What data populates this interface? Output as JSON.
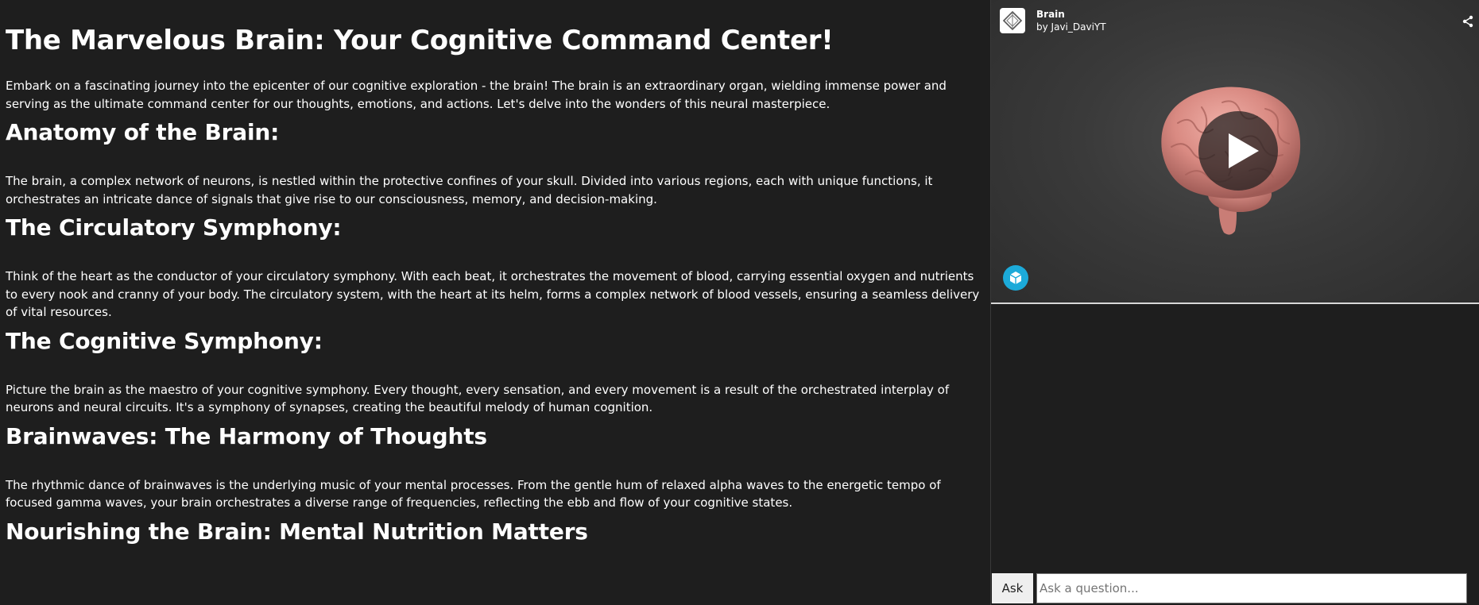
{
  "article": {
    "title": "The Marvelous Brain: Your Cognitive Command Center!",
    "intro": "Embark on a fascinating journey into the epicenter of our cognitive exploration - the brain! The brain is an extraordinary organ, wielding immense power and serving as the ultimate command center for our thoughts, emotions, and actions. Let's delve into the wonders of this neural masterpiece.",
    "sections": [
      {
        "heading": "Anatomy of the Brain:",
        "body": "The brain, a complex network of neurons, is nestled within the protective confines of your skull. Divided into various regions, each with unique functions, it orchestrates an intricate dance of signals that give rise to our consciousness, memory, and decision-making."
      },
      {
        "heading": "The Circulatory Symphony:",
        "body": "Think of the heart as the conductor of your circulatory symphony. With each beat, it orchestrates the movement of blood, carrying essential oxygen and nutrients to every nook and cranny of your body. The circulatory system, with the heart at its helm, forms a complex network of blood vessels, ensuring a seamless delivery of vital resources."
      },
      {
        "heading": "The Cognitive Symphony:",
        "body": "Picture the brain as the maestro of your cognitive symphony. Every thought, every sensation, and every movement is a result of the orchestrated interplay of neurons and neural circuits. It's a symphony of synapses, creating the beautiful melody of human cognition."
      },
      {
        "heading": "Brainwaves: The Harmony of Thoughts",
        "body": "The rhythmic dance of brainwaves is the underlying music of your mental processes. From the gentle hum of relaxed alpha waves to the energetic tempo of focused gamma waves, your brain orchestrates a diverse range of frequencies, reflecting the ebb and flow of your cognitive states."
      },
      {
        "heading": "Nourishing the Brain: Mental Nutrition Matters",
        "body": ""
      }
    ]
  },
  "viewer": {
    "model_name": "Brain",
    "author_prefix": "by",
    "author": "Javi_DaviYT",
    "icons": {
      "logo": "sketchfab-model-logo-icon",
      "share": "share-icon",
      "play": "play-icon",
      "badge": "sketchfab-badge-icon"
    },
    "colors": {
      "badge": "#1caad9",
      "viewer_bg": "#3a3a3a"
    }
  },
  "ask": {
    "button_label": "Ask",
    "placeholder": "Ask a question..."
  }
}
